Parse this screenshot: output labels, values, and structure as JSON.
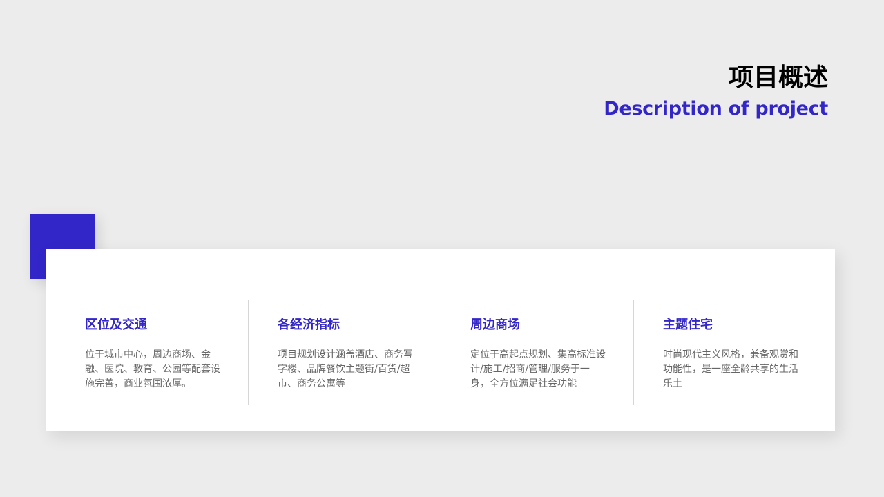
{
  "header": {
    "title_cn": "项目概述",
    "title_en": "Description of project"
  },
  "colors": {
    "accent": "#3226c9",
    "background": "#ececec",
    "card": "#ffffff",
    "heading_text": "#000000",
    "body_text": "#666666"
  },
  "sections": [
    {
      "heading": "区位及交通",
      "text": "位于城市中心，周边商场、金融、医院、教育、公园等配套设施完善，商业氛围浓厚。"
    },
    {
      "heading": "各经济指标",
      "text": "项目规划设计涵盖酒店、商务写字楼、品牌餐饮主题街/百货/超市、商务公寓等"
    },
    {
      "heading": "周边商场",
      "text": "定位于高起点规划、集高标准设计/施工/招商/管理/服务于一身，全方位满足社会功能"
    },
    {
      "heading": "主题住宅",
      "text": "时尚现代主义风格，兼备观赏和功能性，是一座全龄共享的生活乐土"
    }
  ]
}
